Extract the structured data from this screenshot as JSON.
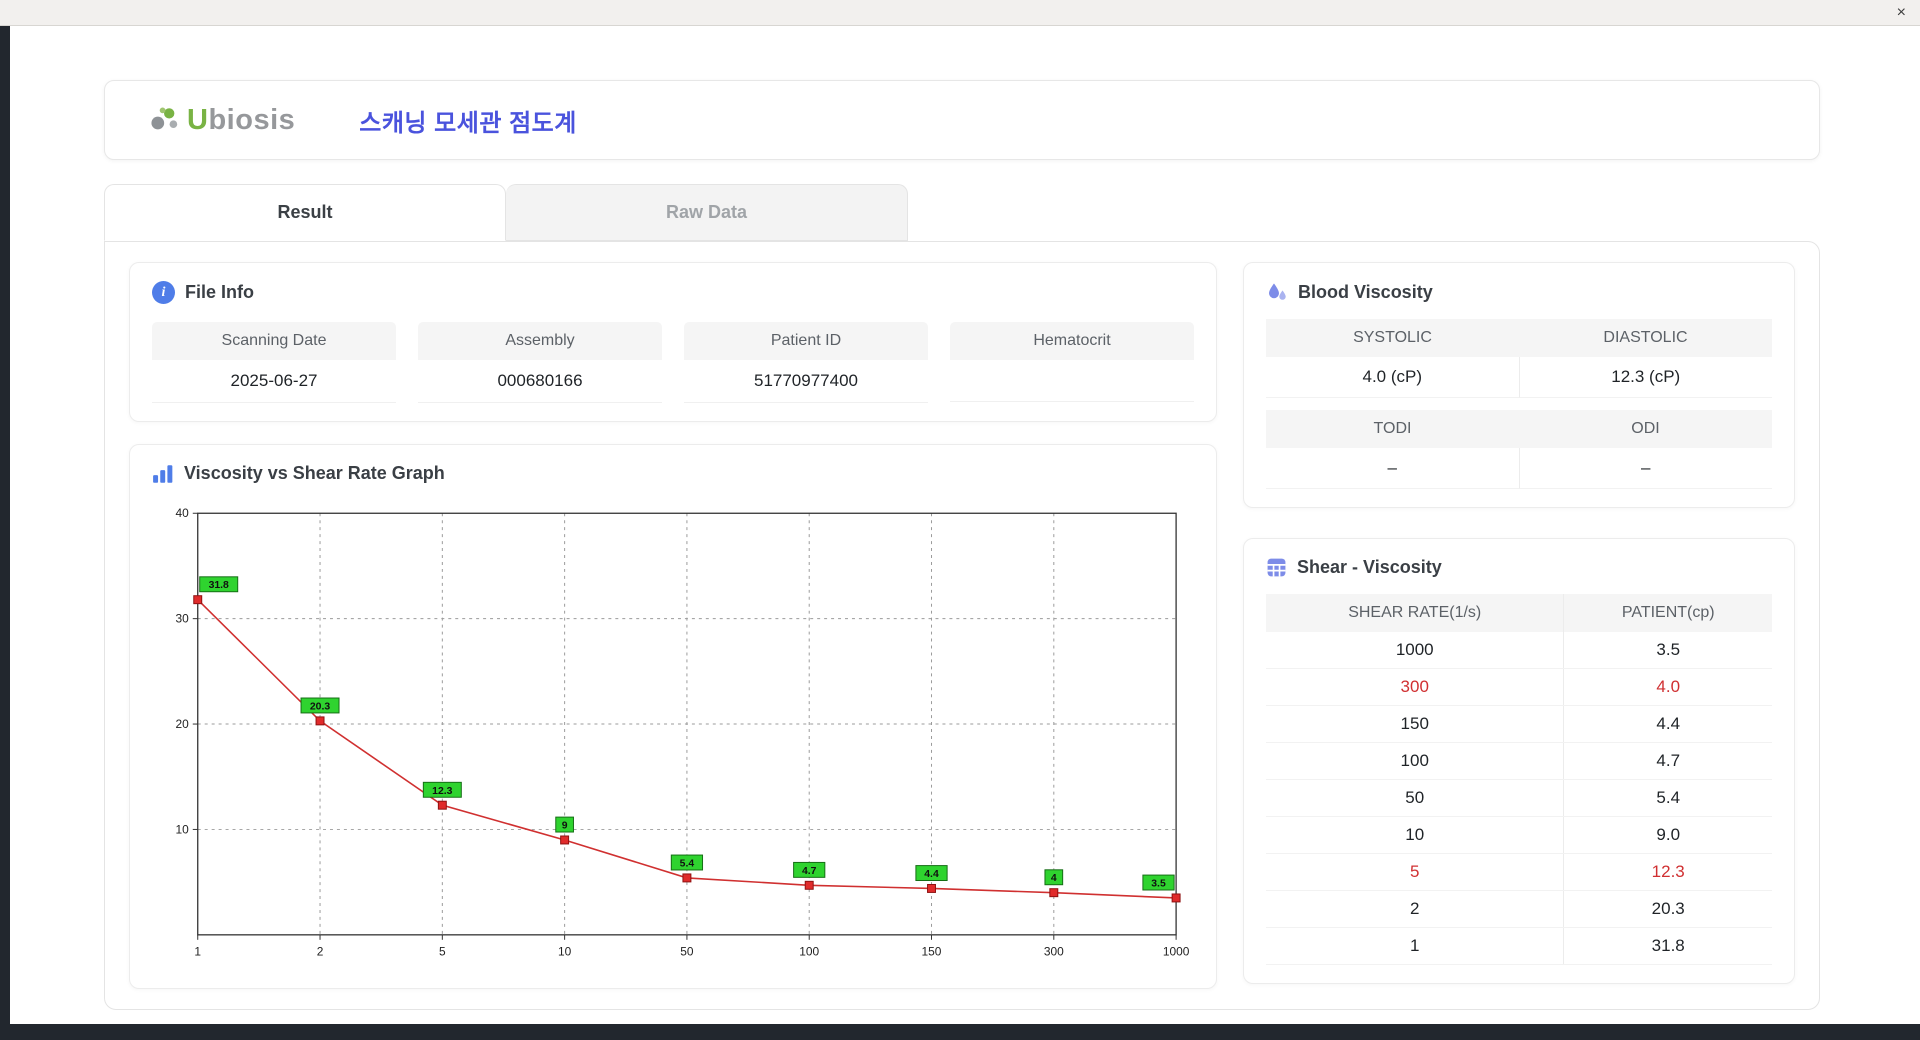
{
  "window": {
    "close_label": "×"
  },
  "icons": {
    "info": "i"
  },
  "colors": {
    "accent": "#4a53dd",
    "logo_green": "#79b344",
    "highlight_red": "#d03032",
    "header_gray": "#f5f5f5"
  },
  "header": {
    "logo_u": "U",
    "logo_rest": "biosis",
    "title": "스캐닝 모세관 점도계"
  },
  "tabs": {
    "result": "Result",
    "raw_data": "Raw Data"
  },
  "file_info": {
    "title": "File Info",
    "fields": [
      {
        "label": "Scanning Date",
        "value": "2025-06-27"
      },
      {
        "label": "Assembly",
        "value": "000680166"
      },
      {
        "label": "Patient ID",
        "value": "51770977400"
      },
      {
        "label": "Hematocrit",
        "value": ""
      }
    ]
  },
  "blood_viscosity": {
    "title": "Blood Viscosity",
    "systolic_label": "SYSTOLIC",
    "diastolic_label": "DIASTOLIC",
    "systolic_value": "4.0 (cP)",
    "diastolic_value": "12.3 (cP)",
    "todi_label": "TODI",
    "odi_label": "ODI",
    "todi_value": "–",
    "odi_value": "–"
  },
  "shear_viscosity": {
    "title": "Shear - Viscosity",
    "columns": [
      "SHEAR RATE(1/s)",
      "PATIENT(cp)"
    ],
    "rows": [
      {
        "shear": "1000",
        "patient": "3.5",
        "highlight": false
      },
      {
        "shear": "300",
        "patient": "4.0",
        "highlight": true
      },
      {
        "shear": "150",
        "patient": "4.4",
        "highlight": false
      },
      {
        "shear": "100",
        "patient": "4.7",
        "highlight": false
      },
      {
        "shear": "50",
        "patient": "5.4",
        "highlight": false
      },
      {
        "shear": "10",
        "patient": "9.0",
        "highlight": false
      },
      {
        "shear": "5",
        "patient": "12.3",
        "highlight": true
      },
      {
        "shear": "2",
        "patient": "20.3",
        "highlight": false
      },
      {
        "shear": "1",
        "patient": "31.8",
        "highlight": false
      }
    ]
  },
  "chart_data": {
    "type": "line",
    "title": "Viscosity vs Shear Rate Graph",
    "xlabel": "",
    "ylabel": "",
    "x": [
      1,
      2,
      5,
      10,
      50,
      100,
      150,
      300,
      1000
    ],
    "values": [
      31.8,
      20.3,
      12.3,
      9,
      5.4,
      4.7,
      4.4,
      4,
      3.5
    ],
    "labels": [
      "31.8",
      "20.3",
      "12.3",
      "9",
      "5.4",
      "4.7",
      "4.4",
      "4",
      "3.5"
    ],
    "ylim": [
      0,
      40
    ],
    "yticks": [
      10,
      20,
      30,
      40
    ],
    "grid": true,
    "legend": "none",
    "line_color": "#d03030",
    "marker_color": "#e02b2b",
    "label_bg": "#2fd32f"
  }
}
